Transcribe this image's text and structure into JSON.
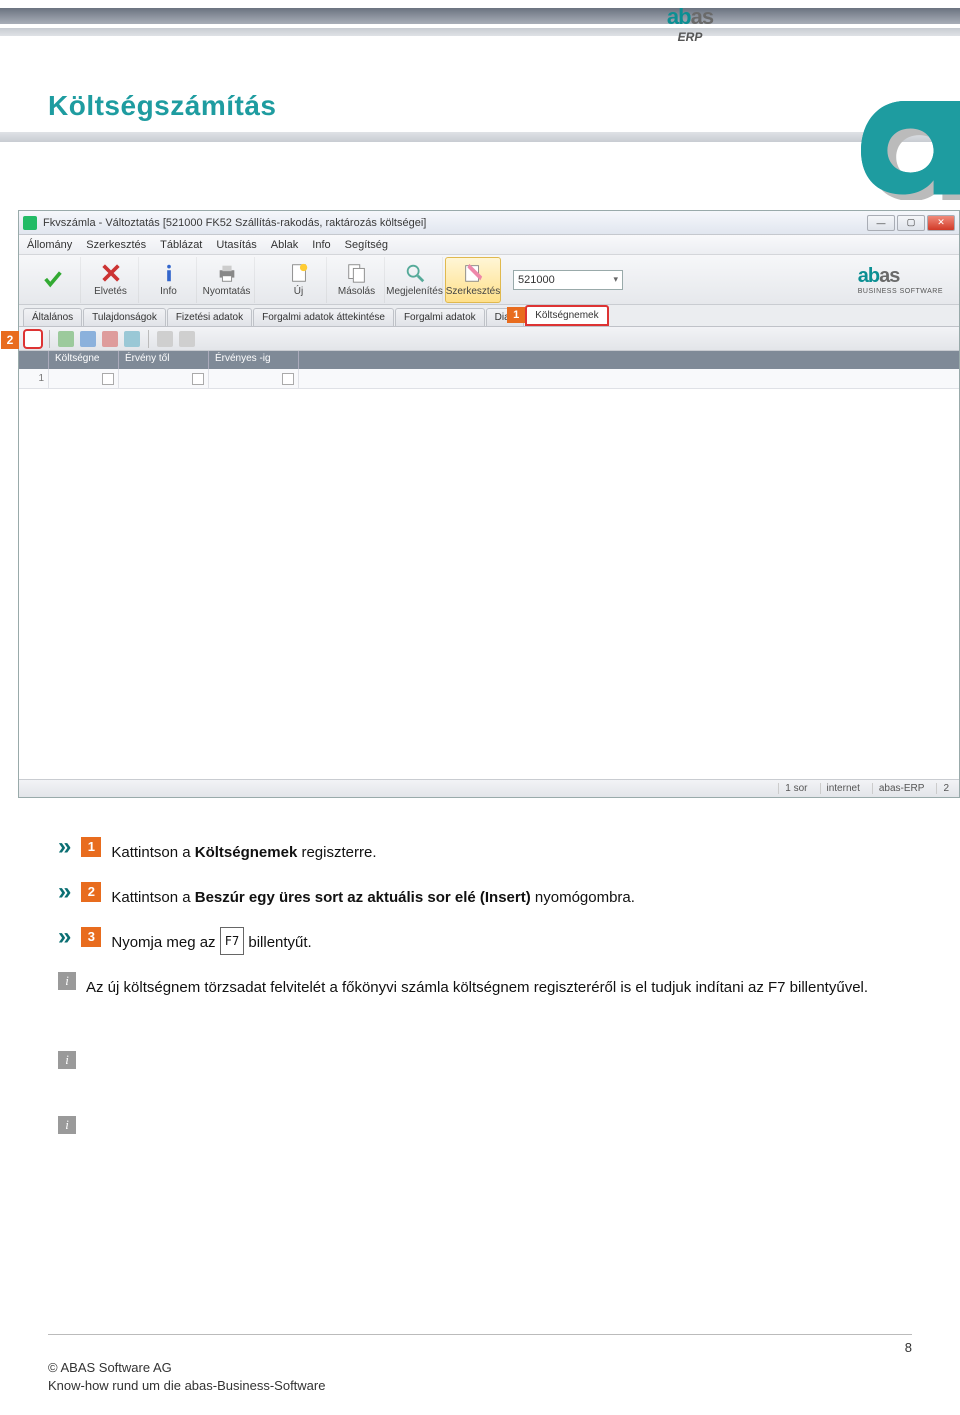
{
  "header": {
    "logo_text_a": "ab",
    "logo_text_b": "as",
    "logo_sub": "ERP"
  },
  "page_title": "Költségszámítás",
  "app": {
    "window_title": "Fkvszámla - Változtatás  [521000   FK52   Szállítás-rakodás, raktározás költségei]",
    "menu": [
      "Állomány",
      "Szerkesztés",
      "Táblázat",
      "Utasítás",
      "Ablak",
      "Info",
      "Segítség"
    ],
    "toolbar": [
      {
        "label": "Mentés"
      },
      {
        "label": "Elvetés"
      },
      {
        "label": "Info"
      },
      {
        "label": "Nyomtatás"
      },
      {
        "label": "Új"
      },
      {
        "label": "Másolás"
      },
      {
        "label": "Megjelenítés"
      },
      {
        "label": "Szerkesztés"
      }
    ],
    "combo_value": "521000",
    "logo_sub": "BUSINESS SOFTWARE",
    "tabs": [
      "Általános",
      "Tulajdonságok",
      "Fizetési adatok",
      "Forgalmi adatok áttekintése",
      "Forgalmi adatok",
      "Diagram",
      "Költségnemek"
    ],
    "tab_badge_1": "1",
    "side_badge_2": "2",
    "grid_headers": [
      "",
      "Költségne",
      "Érvény től",
      "Érvényes -ig"
    ],
    "grid_row_num": "1",
    "status": {
      "rows": "1 sor",
      "net": "internet",
      "app": "abas-ERP",
      "n": "2"
    }
  },
  "instructions": {
    "step1_badge": "1",
    "step1_pre": "Kattintson  a ",
    "step1_bold": "Költségnemek",
    "step1_post": " regiszterre.",
    "step2_badge": "2",
    "step2_pre": "Kattintson  a ",
    "step2_bold": "Beszúr egy üres sort az aktuális sor elé (Insert)",
    "step2_post": " nyomógombra.",
    "step3_badge": "3",
    "step3_pre": "Nyomja  meg  az  ",
    "step3_key": "F7",
    "step3_post": "  billentyűt.",
    "info_text": "Az  új  költségnem  törzsadat  felvitelét  a  főkönyvi  számla   költségnem  regiszteréről   is  el  tudjuk indítani  az  F7  billentyűvel."
  },
  "footer": {
    "page": "8",
    "line1": "© ABAS Software AG",
    "line2": "Know-how  rund  um  die  abas-Business-Software"
  }
}
